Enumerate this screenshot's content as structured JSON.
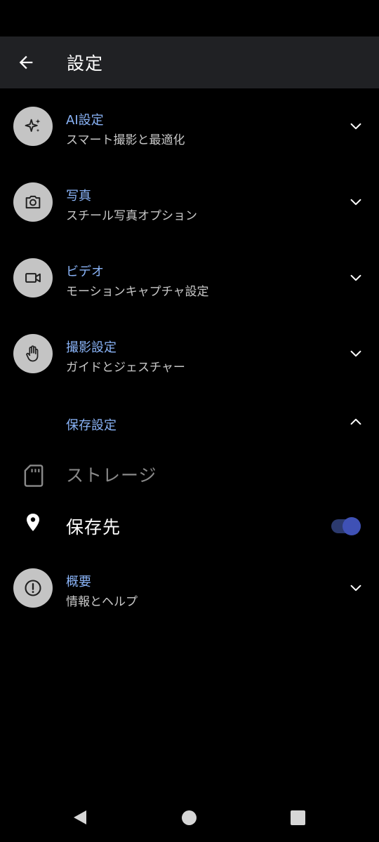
{
  "app_bar": {
    "back_icon": "arrow-left-icon",
    "title": "設定"
  },
  "settings": [
    {
      "icon": "sparkle-icon",
      "title": "AI設定",
      "subtitle": "スマート撮影と最適化",
      "expanded": false
    },
    {
      "icon": "camera-icon",
      "title": "写真",
      "subtitle": "スチール写真オプション",
      "expanded": false
    },
    {
      "icon": "videocam-icon",
      "title": "ビデオ",
      "subtitle": "モーションキャプチャ設定",
      "expanded": false
    },
    {
      "icon": "hand-icon",
      "title": "撮影設定",
      "subtitle": "ガイドとジェスチャー",
      "expanded": false
    }
  ],
  "storage_section": {
    "title": "保存設定",
    "expanded": true,
    "storage_label": "ストレージ",
    "save_location_label": "保存先",
    "save_location_toggle_on": true
  },
  "about": {
    "icon": "info-icon",
    "title": "概要",
    "subtitle": "情報とヘルプ",
    "expanded": false
  },
  "colors": {
    "accent": "#8ab4f8",
    "app_bar_bg": "#202124",
    "icon_circle": "#c4c4c4",
    "toggle_thumb": "#3f51b5"
  },
  "nav_bar": {
    "back_icon": "nav-back-triangle-icon",
    "home_icon": "nav-home-circle-icon",
    "recents_icon": "nav-recents-square-icon"
  }
}
